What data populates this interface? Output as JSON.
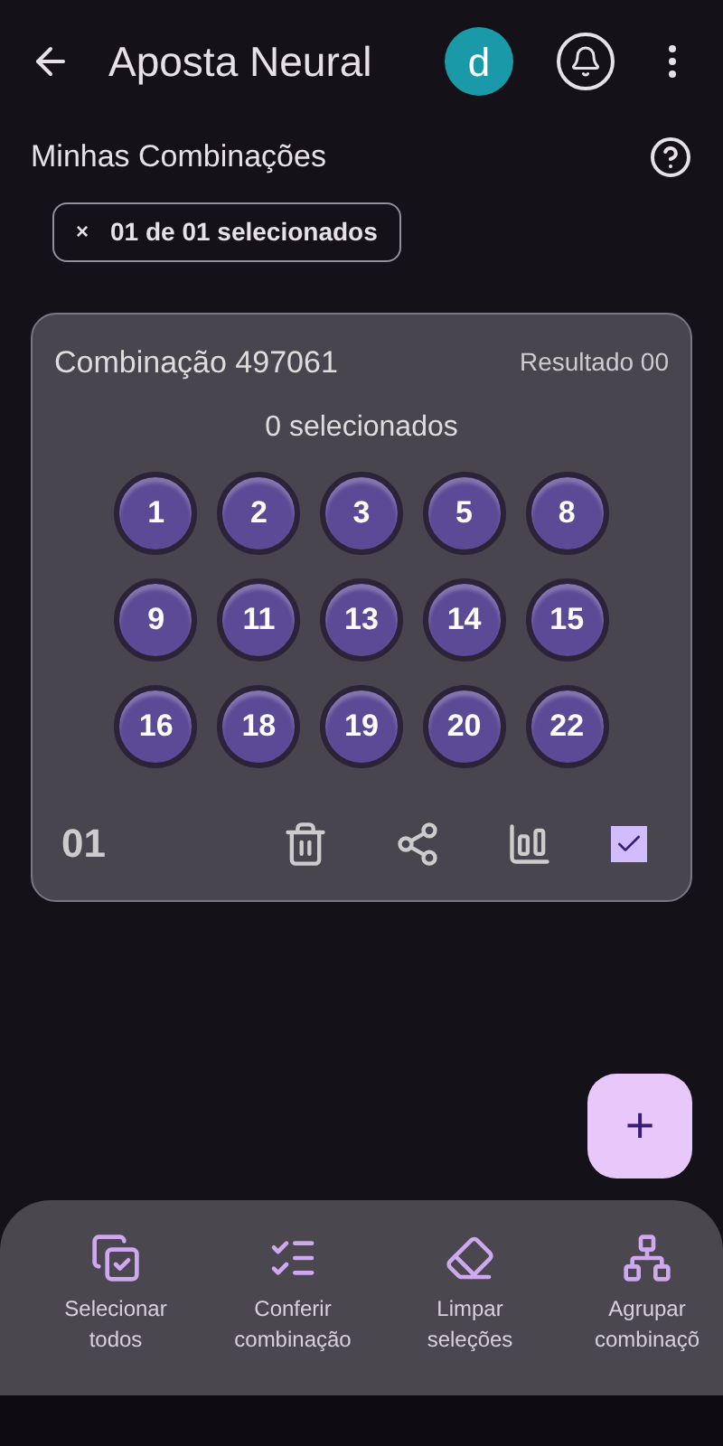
{
  "app_bar": {
    "title": "Aposta Neural",
    "avatar": "d"
  },
  "section": {
    "title": "Minhas Combinações"
  },
  "chip": {
    "close": "×",
    "label": "01 de 01 selecionados"
  },
  "card": {
    "title": "Combinação 497061",
    "result": "Resultado 00",
    "selected_count": "0 selecionados",
    "numbers": [
      "1",
      "2",
      "3",
      "5",
      "8",
      "9",
      "11",
      "13",
      "14",
      "15",
      "16",
      "18",
      "19",
      "20",
      "22"
    ],
    "index": "01",
    "checked": true
  },
  "fab": {
    "label": "+"
  },
  "actions": [
    {
      "kind": "select-all",
      "lines": [
        "Selecionar",
        "todos"
      ]
    },
    {
      "kind": "check",
      "lines": [
        "Conferir",
        "combinação"
      ]
    },
    {
      "kind": "clear",
      "lines": [
        "Limpar",
        "seleções"
      ]
    },
    {
      "kind": "group",
      "lines": [
        "Agrupar",
        "combinaçõ"
      ]
    }
  ]
}
